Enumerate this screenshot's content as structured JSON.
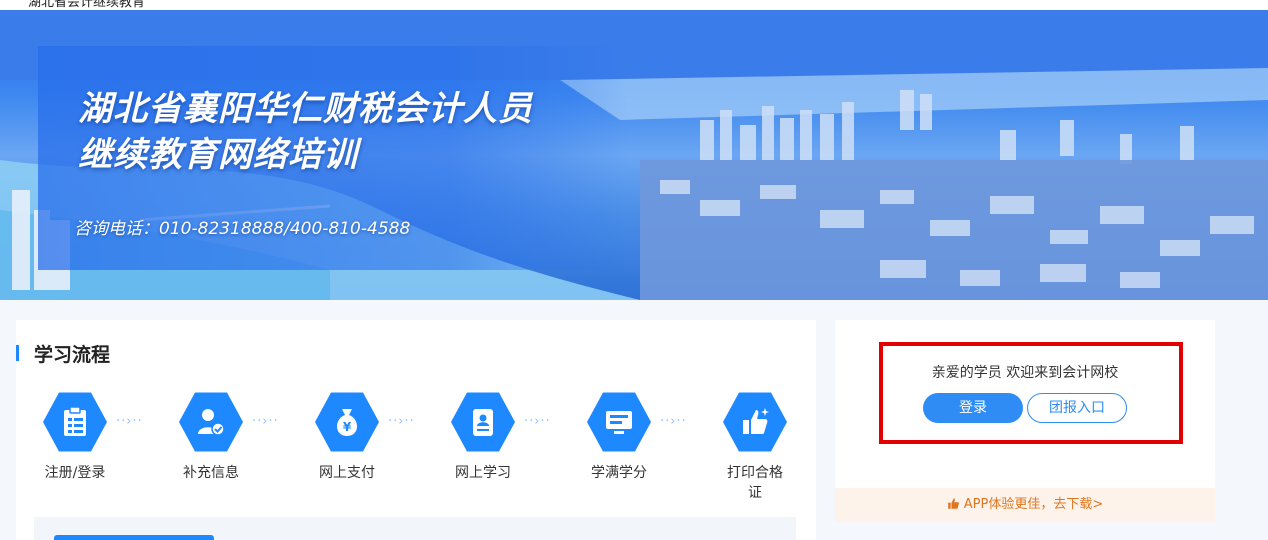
{
  "topbar": {
    "text": "湖北省会计继续教育"
  },
  "banner": {
    "title_line1": "湖北省襄阳华仁财税会计人员",
    "title_line2": "继续教育网络培训",
    "phone": "咨询电话：010-82318888/400-810-4588"
  },
  "process": {
    "title": "学习流程",
    "steps": [
      {
        "label": "注册/登录",
        "icon": "clipboard-icon"
      },
      {
        "label": "补充信息",
        "icon": "user-check-icon"
      },
      {
        "label": "网上支付",
        "icon": "money-bag-icon"
      },
      {
        "label": "网上学习",
        "icon": "badge-id-icon"
      },
      {
        "label": "学满学分",
        "icon": "monitor-icon"
      },
      {
        "label": "打印合格证",
        "icon": "thumbs-up-icon"
      }
    ],
    "arrow": "··›··"
  },
  "login": {
    "welcome": "亲爱的学员 欢迎来到会计网校",
    "login_label": "登录",
    "group_label": "团报入口",
    "app_text": "APP体验更佳，去下载>"
  },
  "colors": {
    "accent": "#1e88ff",
    "highlight": "#e00000",
    "app_text": "#e0751f"
  }
}
